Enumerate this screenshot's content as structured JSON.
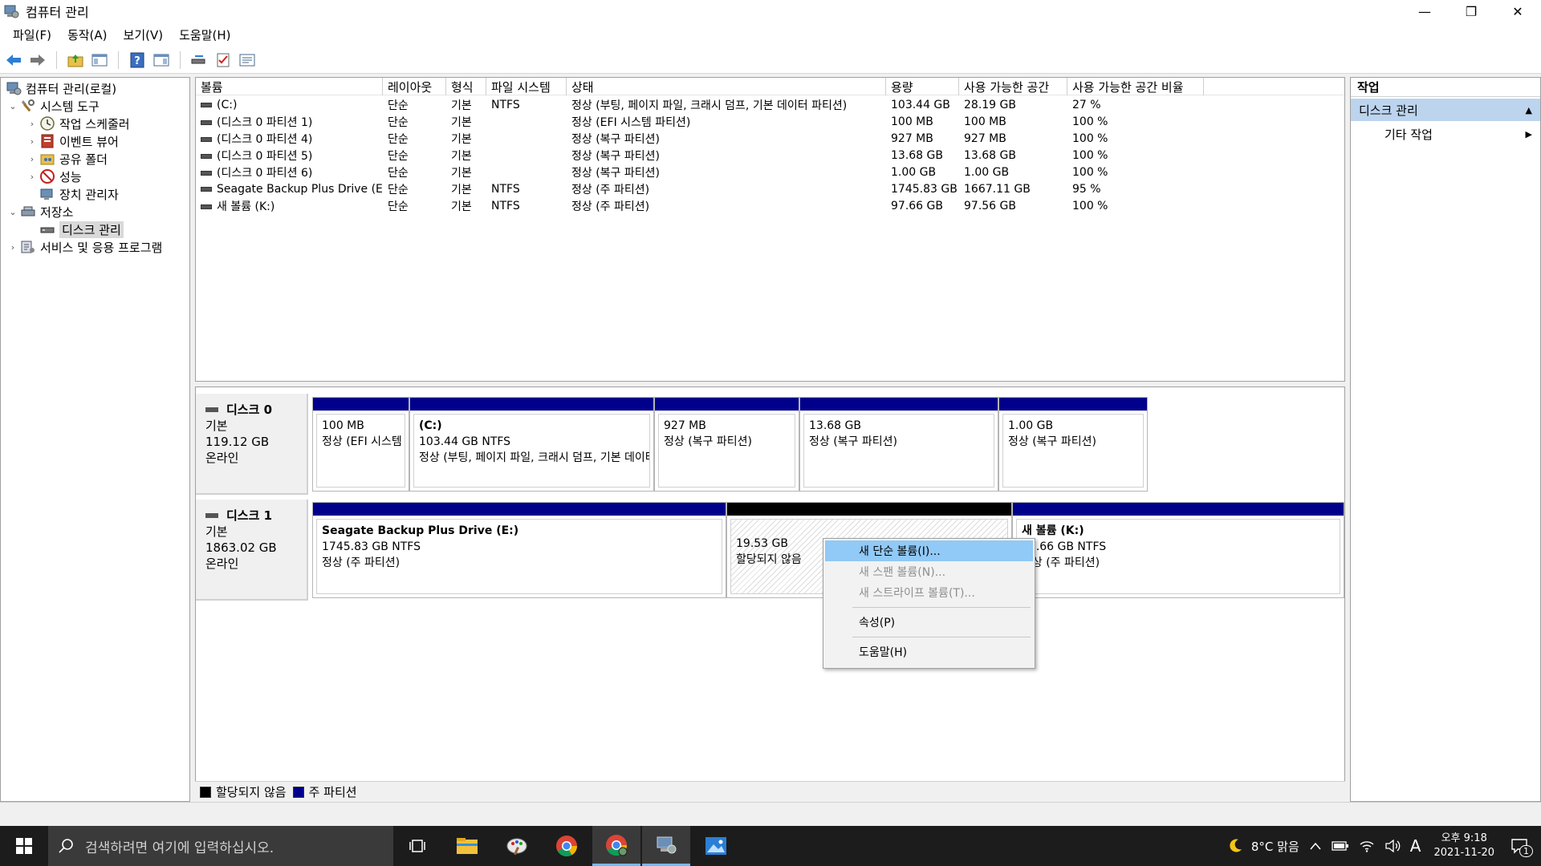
{
  "window": {
    "title": "컴퓨터 관리",
    "minimize": "—",
    "restore": "❐",
    "close": "✕"
  },
  "menu": [
    "파일(F)",
    "동작(A)",
    "보기(V)",
    "도움말(H)"
  ],
  "tree": {
    "items": [
      {
        "label": "컴퓨터 관리(로컬)",
        "level": 0,
        "chev": "",
        "icon": "computer-management-icon"
      },
      {
        "label": "시스템 도구",
        "level": 1,
        "chev": "⌄",
        "icon": "system-tools-icon"
      },
      {
        "label": "작업 스케줄러",
        "level": 2,
        "chev": "›",
        "icon": "task-scheduler-icon"
      },
      {
        "label": "이벤트 뷰어",
        "level": 2,
        "chev": "›",
        "icon": "event-viewer-icon"
      },
      {
        "label": "공유 폴더",
        "level": 2,
        "chev": "›",
        "icon": "shared-folders-icon"
      },
      {
        "label": "성능",
        "level": 2,
        "chev": "›",
        "icon": "performance-icon"
      },
      {
        "label": "장치 관리자",
        "level": 2,
        "chev": "",
        "icon": "device-manager-icon"
      },
      {
        "label": "저장소",
        "level": 1,
        "chev": "⌄",
        "icon": "storage-icon"
      },
      {
        "label": "디스크 관리",
        "level": 2,
        "chev": "",
        "icon": "disk-management-icon",
        "selected": true
      },
      {
        "label": "서비스 및 응용 프로그램",
        "level": 1,
        "chev": "›",
        "icon": "services-apps-icon"
      }
    ]
  },
  "volumes": {
    "columns": [
      "볼륨",
      "레이아웃",
      "형식",
      "파일 시스템",
      "상태",
      "용량",
      "사용 가능한 공간",
      "사용 가능한 공간 비율"
    ],
    "rows": [
      [
        "(C:)",
        "단순",
        "기본",
        "NTFS",
        "정상 (부팅, 페이지 파일, 크래시 덤프, 기본 데이터 파티션)",
        "103.44 GB",
        "28.19 GB",
        "27 %"
      ],
      [
        "(디스크 0 파티션 1)",
        "단순",
        "기본",
        "",
        "정상 (EFI 시스템 파티션)",
        "100 MB",
        "100 MB",
        "100 %"
      ],
      [
        "(디스크 0 파티션 4)",
        "단순",
        "기본",
        "",
        "정상 (복구 파티션)",
        "927 MB",
        "927 MB",
        "100 %"
      ],
      [
        "(디스크 0 파티션 5)",
        "단순",
        "기본",
        "",
        "정상 (복구 파티션)",
        "13.68 GB",
        "13.68 GB",
        "100 %"
      ],
      [
        "(디스크 0 파티션 6)",
        "단순",
        "기본",
        "",
        "정상 (복구 파티션)",
        "1.00 GB",
        "1.00 GB",
        "100 %"
      ],
      [
        "Seagate Backup Plus Drive (E:)",
        "단순",
        "기본",
        "NTFS",
        "정상 (주 파티션)",
        "1745.83 GB",
        "1667.11 GB",
        "95 %"
      ],
      [
        "새 볼륨 (K:)",
        "단순",
        "기본",
        "NTFS",
        "정상 (주 파티션)",
        "97.66 GB",
        "97.56 GB",
        "100 %"
      ]
    ]
  },
  "disks": [
    {
      "name": "디스크 0",
      "type": "기본",
      "size": "119.12 GB",
      "status": "온라인",
      "partitions": [
        {
          "name": "",
          "line1": "100 MB",
          "line2": "정상 (EFI 시스템 파티션)"
        },
        {
          "name": "(C:)",
          "line1": "103.44 GB NTFS",
          "line2": "정상 (부팅, 페이지 파일, 크래시 덤프, 기본 데이터 파티션)"
        },
        {
          "name": "",
          "line1": "927 MB",
          "line2": "정상 (복구 파티션)"
        },
        {
          "name": "",
          "line1": "13.68 GB",
          "line2": "정상 (복구 파티션)"
        },
        {
          "name": "",
          "line1": "1.00 GB",
          "line2": "정상 (복구 파티션)"
        }
      ]
    },
    {
      "name": "디스크 1",
      "type": "기본",
      "size": "1863.02 GB",
      "status": "온라인",
      "partitions": [
        {
          "name": "Seagate Backup Plus Drive  (E:)",
          "line1": "1745.83 GB NTFS",
          "line2": "정상 (주 파티션)"
        },
        {
          "name": "",
          "line1": "19.53 GB",
          "line2": "할당되지 않음",
          "unallocated": true
        },
        {
          "name": "새 볼륨  (K:)",
          "line1": "97.66 GB NTFS",
          "line2": "정상 (주 파티션)"
        }
      ]
    }
  ],
  "legend": {
    "unallocated": "할당되지 않음",
    "primary": "주 파티션"
  },
  "actions": {
    "header": "작업",
    "section": "디스크 관리",
    "more": "기타 작업"
  },
  "context_menu": [
    {
      "label": "새 단순 볼륨(I)...",
      "state": "highlighted"
    },
    {
      "label": "새 스팬 볼륨(N)...",
      "state": "disabled"
    },
    {
      "label": "새 스트라이프 볼륨(T)...",
      "state": "disabled"
    },
    {
      "label": "속성(P)",
      "state": "normal"
    },
    {
      "label": "도움말(H)",
      "state": "normal"
    }
  ],
  "taskbar": {
    "search_placeholder": "검색하려면 여기에 입력하십시오.",
    "weather": "8°C 맑음",
    "ime": "A",
    "time": "오후 9:18",
    "date": "2021-11-20",
    "notification_count": "1"
  },
  "colors": {
    "primary_partition": "#00008b",
    "unallocated": "#000000",
    "selection": "#91c9f7",
    "action_section": "#bcd4ee"
  }
}
